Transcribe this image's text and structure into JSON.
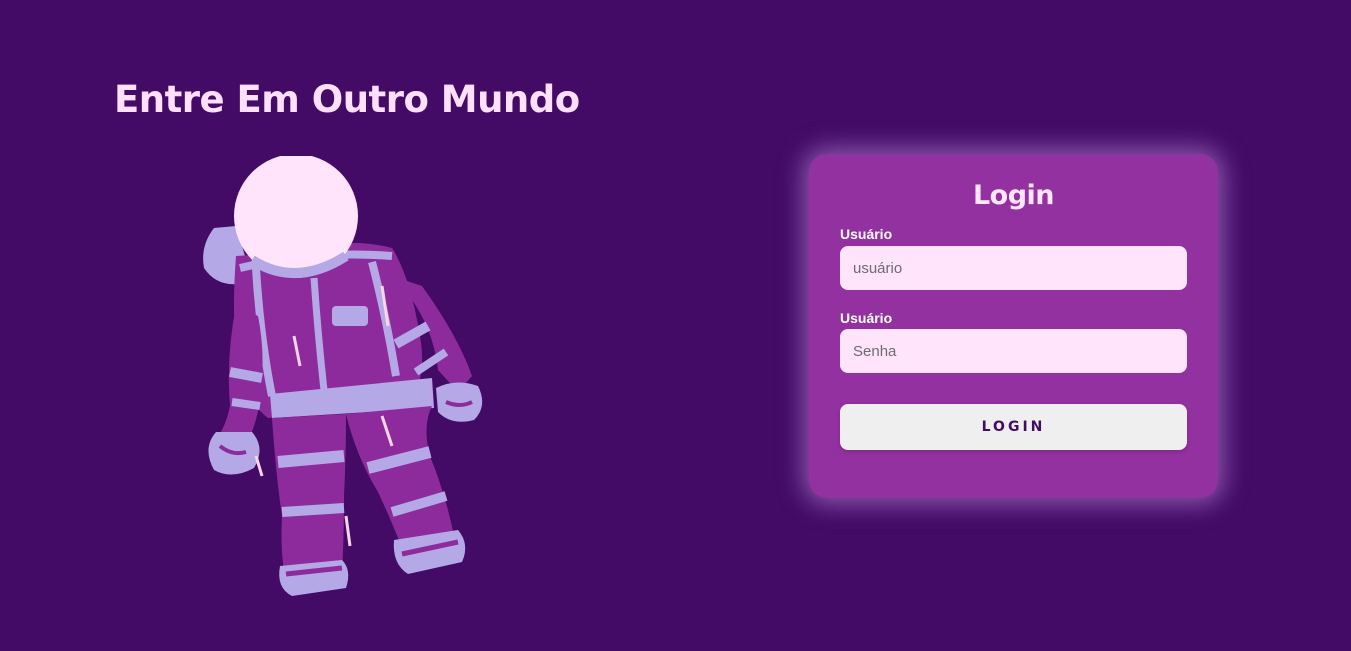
{
  "hero": {
    "title": "Entre Em Outro Mundo",
    "image_icon": "astronaut-illustration"
  },
  "login_card": {
    "title": "Login",
    "user_label": "Usuário",
    "user_placeholder": "usuário",
    "password_label": "Usuário",
    "password_placeholder": "Senha",
    "button_label": "LOGIN"
  },
  "colors": {
    "background": "#430b66",
    "card": "#9331a0",
    "input_bg": "#ffe4fc",
    "button_bg": "#efefef",
    "title_text": "#ffe0fb",
    "astronaut_light": "#b4a9e6",
    "astronaut_dark": "#8e2b9c"
  }
}
